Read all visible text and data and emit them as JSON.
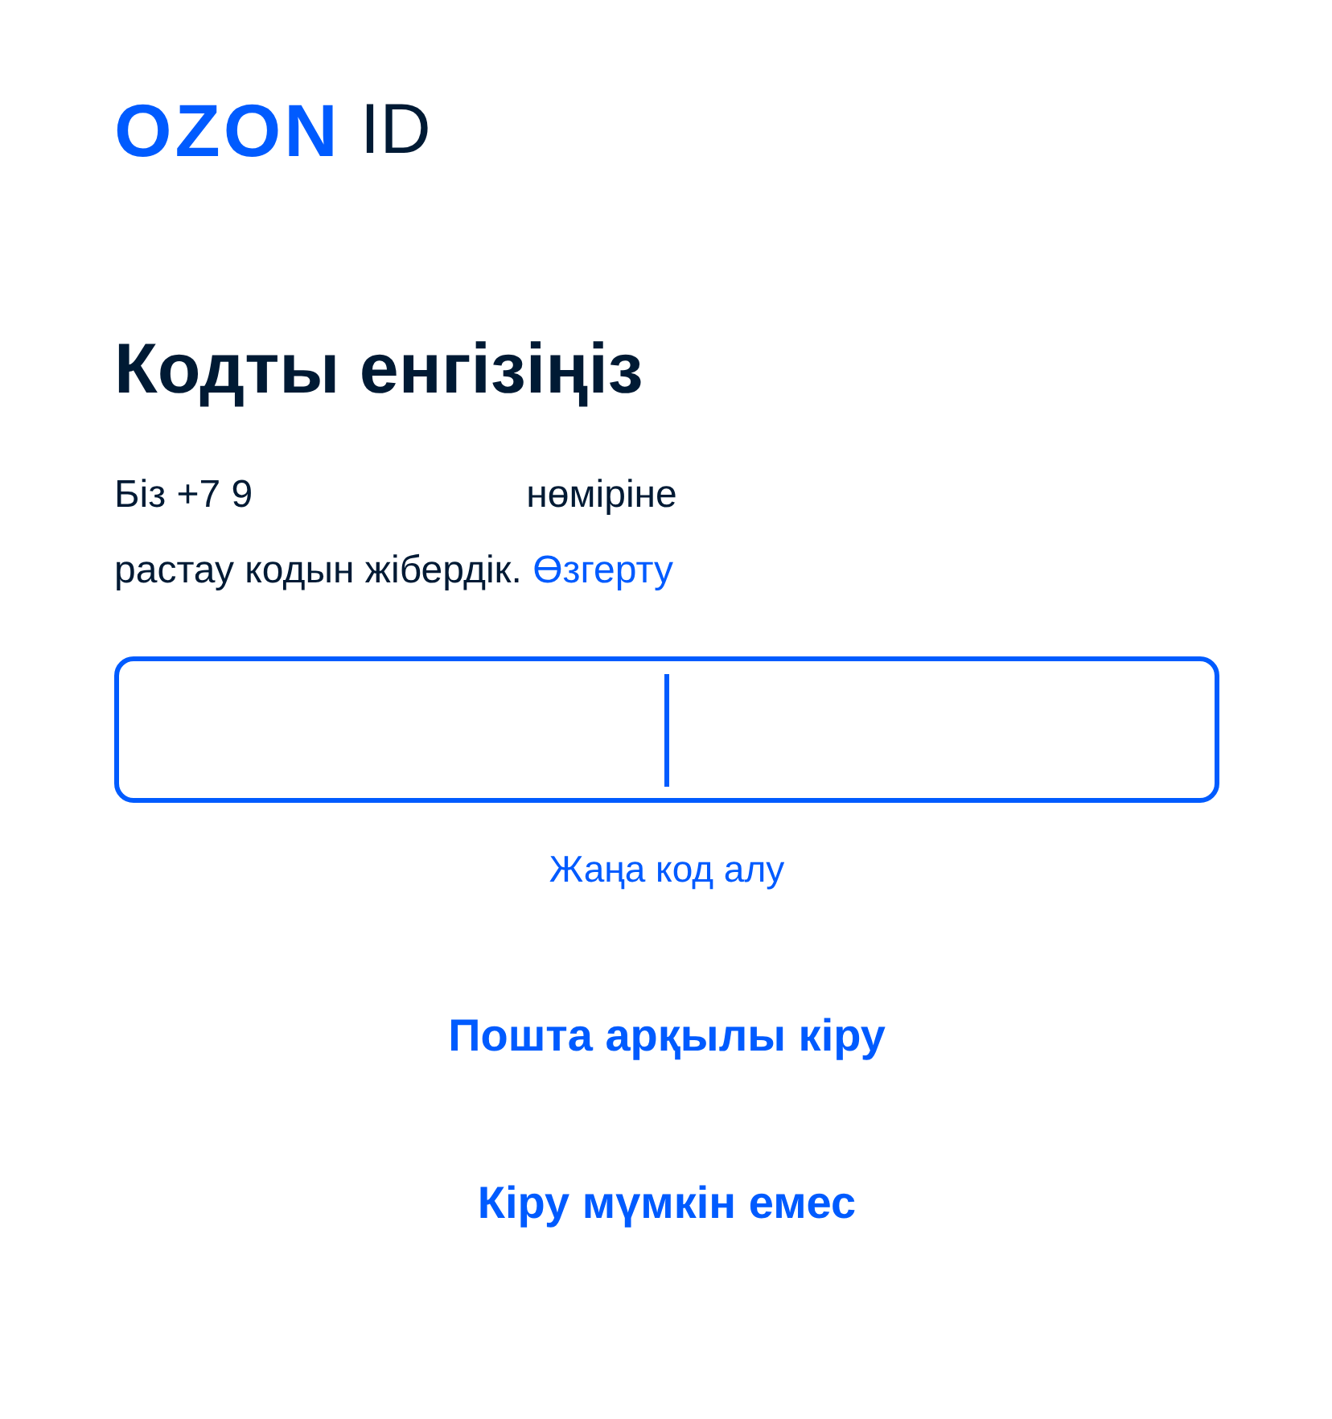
{
  "logo": {
    "brand": "OZON",
    "suffix": "ID"
  },
  "title": "Кодты енгізіңіз",
  "message": {
    "before_phone": "Біз",
    "phone": "+7 9",
    "after_phone": "нөміріне",
    "line_2": "растау кодын жібердік.",
    "change_link": "Өзгерту"
  },
  "code_field": {
    "focused": true
  },
  "links": [
    {
      "label": "Жаңа код алу",
      "kind": "small"
    },
    {
      "label": "Пошта арқылы кіру",
      "kind": "bold"
    },
    {
      "label": "Кіру мүмкін емес",
      "kind": "bold"
    }
  ]
}
